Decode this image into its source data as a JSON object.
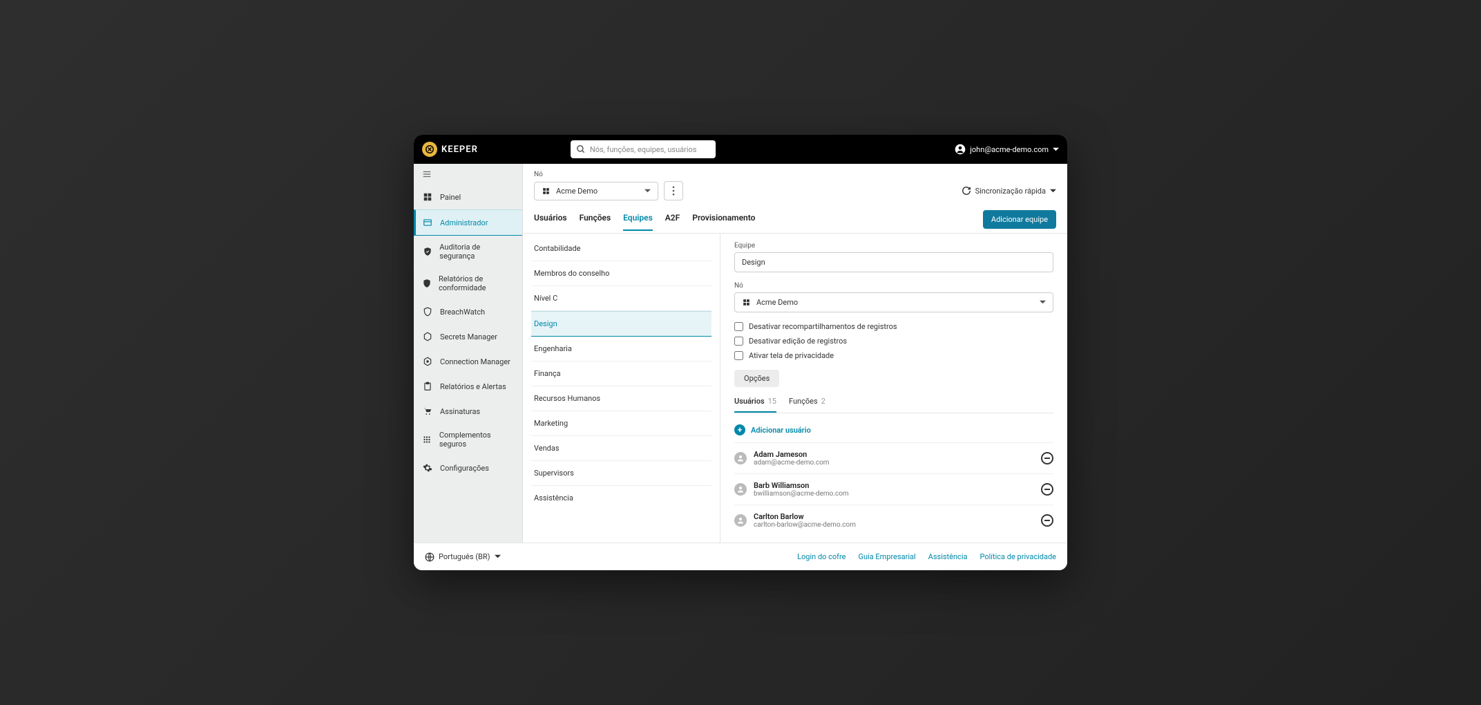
{
  "brand": "KEEPER",
  "search": {
    "placeholder": "Nós, funções, equipes, usuários"
  },
  "account": {
    "email": "john@acme-demo.com"
  },
  "sidebar": {
    "items": [
      {
        "label": "Painel"
      },
      {
        "label": "Administrador"
      },
      {
        "label": "Auditoria de segurança"
      },
      {
        "label": "Relatórios de conformidade"
      },
      {
        "label": "BreachWatch"
      },
      {
        "label": "Secrets Manager"
      },
      {
        "label": "Connection Manager"
      },
      {
        "label": "Relatórios e Alertas"
      },
      {
        "label": "Assinaturas"
      },
      {
        "label": "Complementos seguros"
      },
      {
        "label": "Configurações"
      }
    ]
  },
  "main": {
    "node_label": "Nó",
    "node_value": "Acme Demo",
    "sync_label": "Sincronização rápida",
    "tabs": [
      {
        "label": "Usuários"
      },
      {
        "label": "Funções"
      },
      {
        "label": "Equipes"
      },
      {
        "label": "A2F"
      },
      {
        "label": "Provisionamento"
      }
    ],
    "add_team_button": "Adicionar equipe"
  },
  "teams": [
    {
      "label": "Contabilidade"
    },
    {
      "label": "Membros do conselho"
    },
    {
      "label": "Nível C"
    },
    {
      "label": "Design"
    },
    {
      "label": "Engenharia"
    },
    {
      "label": "Finança"
    },
    {
      "label": "Recursos Humanos"
    },
    {
      "label": "Marketing"
    },
    {
      "label": "Vendas"
    },
    {
      "label": "Supervisors"
    },
    {
      "label": "Assistência"
    }
  ],
  "detail": {
    "team_label": "Equipe",
    "team_value": "Design",
    "node_label": "Nó",
    "node_value": "Acme Demo",
    "checkboxes": [
      {
        "label": "Desativar recompartilhamentos de registros"
      },
      {
        "label": "Desativar edição de registros"
      },
      {
        "label": "Ativar tela de privacidade"
      }
    ],
    "options_button": "Opções",
    "subtabs": {
      "users": {
        "label": "Usuários",
        "count": "15"
      },
      "roles": {
        "label": "Funções",
        "count": "2"
      }
    },
    "add_user": "Adicionar usuário",
    "users": [
      {
        "name": "Adam Jameson",
        "email": "adam@acme-demo.com"
      },
      {
        "name": "Barb Williamson",
        "email": "bwilliamson@acme-demo.com"
      },
      {
        "name": "Carlton Barlow",
        "email": "carlton-barlow@acme-demo.com"
      }
    ]
  },
  "footer": {
    "language": "Português (BR)",
    "links": [
      {
        "label": "Login do cofre"
      },
      {
        "label": "Guia Empresarial"
      },
      {
        "label": "Assistência"
      },
      {
        "label": "Política de privacidade"
      }
    ]
  }
}
